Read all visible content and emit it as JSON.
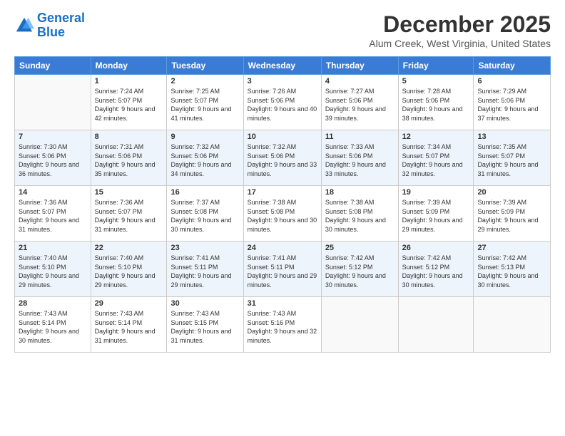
{
  "logo": {
    "line1": "General",
    "line2": "Blue"
  },
  "title": "December 2025",
  "location": "Alum Creek, West Virginia, United States",
  "days_header": [
    "Sunday",
    "Monday",
    "Tuesday",
    "Wednesday",
    "Thursday",
    "Friday",
    "Saturday"
  ],
  "weeks": [
    [
      {
        "num": "",
        "sunrise": "",
        "sunset": "",
        "daylight": ""
      },
      {
        "num": "1",
        "sunrise": "Sunrise: 7:24 AM",
        "sunset": "Sunset: 5:07 PM",
        "daylight": "Daylight: 9 hours and 42 minutes."
      },
      {
        "num": "2",
        "sunrise": "Sunrise: 7:25 AM",
        "sunset": "Sunset: 5:07 PM",
        "daylight": "Daylight: 9 hours and 41 minutes."
      },
      {
        "num": "3",
        "sunrise": "Sunrise: 7:26 AM",
        "sunset": "Sunset: 5:06 PM",
        "daylight": "Daylight: 9 hours and 40 minutes."
      },
      {
        "num": "4",
        "sunrise": "Sunrise: 7:27 AM",
        "sunset": "Sunset: 5:06 PM",
        "daylight": "Daylight: 9 hours and 39 minutes."
      },
      {
        "num": "5",
        "sunrise": "Sunrise: 7:28 AM",
        "sunset": "Sunset: 5:06 PM",
        "daylight": "Daylight: 9 hours and 38 minutes."
      },
      {
        "num": "6",
        "sunrise": "Sunrise: 7:29 AM",
        "sunset": "Sunset: 5:06 PM",
        "daylight": "Daylight: 9 hours and 37 minutes."
      }
    ],
    [
      {
        "num": "7",
        "sunrise": "Sunrise: 7:30 AM",
        "sunset": "Sunset: 5:06 PM",
        "daylight": "Daylight: 9 hours and 36 minutes."
      },
      {
        "num": "8",
        "sunrise": "Sunrise: 7:31 AM",
        "sunset": "Sunset: 5:06 PM",
        "daylight": "Daylight: 9 hours and 35 minutes."
      },
      {
        "num": "9",
        "sunrise": "Sunrise: 7:32 AM",
        "sunset": "Sunset: 5:06 PM",
        "daylight": "Daylight: 9 hours and 34 minutes."
      },
      {
        "num": "10",
        "sunrise": "Sunrise: 7:32 AM",
        "sunset": "Sunset: 5:06 PM",
        "daylight": "Daylight: 9 hours and 33 minutes."
      },
      {
        "num": "11",
        "sunrise": "Sunrise: 7:33 AM",
        "sunset": "Sunset: 5:06 PM",
        "daylight": "Daylight: 9 hours and 33 minutes."
      },
      {
        "num": "12",
        "sunrise": "Sunrise: 7:34 AM",
        "sunset": "Sunset: 5:07 PM",
        "daylight": "Daylight: 9 hours and 32 minutes."
      },
      {
        "num": "13",
        "sunrise": "Sunrise: 7:35 AM",
        "sunset": "Sunset: 5:07 PM",
        "daylight": "Daylight: 9 hours and 31 minutes."
      }
    ],
    [
      {
        "num": "14",
        "sunrise": "Sunrise: 7:36 AM",
        "sunset": "Sunset: 5:07 PM",
        "daylight": "Daylight: 9 hours and 31 minutes."
      },
      {
        "num": "15",
        "sunrise": "Sunrise: 7:36 AM",
        "sunset": "Sunset: 5:07 PM",
        "daylight": "Daylight: 9 hours and 31 minutes."
      },
      {
        "num": "16",
        "sunrise": "Sunrise: 7:37 AM",
        "sunset": "Sunset: 5:08 PM",
        "daylight": "Daylight: 9 hours and 30 minutes."
      },
      {
        "num": "17",
        "sunrise": "Sunrise: 7:38 AM",
        "sunset": "Sunset: 5:08 PM",
        "daylight": "Daylight: 9 hours and 30 minutes."
      },
      {
        "num": "18",
        "sunrise": "Sunrise: 7:38 AM",
        "sunset": "Sunset: 5:08 PM",
        "daylight": "Daylight: 9 hours and 30 minutes."
      },
      {
        "num": "19",
        "sunrise": "Sunrise: 7:39 AM",
        "sunset": "Sunset: 5:09 PM",
        "daylight": "Daylight: 9 hours and 29 minutes."
      },
      {
        "num": "20",
        "sunrise": "Sunrise: 7:39 AM",
        "sunset": "Sunset: 5:09 PM",
        "daylight": "Daylight: 9 hours and 29 minutes."
      }
    ],
    [
      {
        "num": "21",
        "sunrise": "Sunrise: 7:40 AM",
        "sunset": "Sunset: 5:10 PM",
        "daylight": "Daylight: 9 hours and 29 minutes."
      },
      {
        "num": "22",
        "sunrise": "Sunrise: 7:40 AM",
        "sunset": "Sunset: 5:10 PM",
        "daylight": "Daylight: 9 hours and 29 minutes."
      },
      {
        "num": "23",
        "sunrise": "Sunrise: 7:41 AM",
        "sunset": "Sunset: 5:11 PM",
        "daylight": "Daylight: 9 hours and 29 minutes."
      },
      {
        "num": "24",
        "sunrise": "Sunrise: 7:41 AM",
        "sunset": "Sunset: 5:11 PM",
        "daylight": "Daylight: 9 hours and 29 minutes."
      },
      {
        "num": "25",
        "sunrise": "Sunrise: 7:42 AM",
        "sunset": "Sunset: 5:12 PM",
        "daylight": "Daylight: 9 hours and 30 minutes."
      },
      {
        "num": "26",
        "sunrise": "Sunrise: 7:42 AM",
        "sunset": "Sunset: 5:12 PM",
        "daylight": "Daylight: 9 hours and 30 minutes."
      },
      {
        "num": "27",
        "sunrise": "Sunrise: 7:42 AM",
        "sunset": "Sunset: 5:13 PM",
        "daylight": "Daylight: 9 hours and 30 minutes."
      }
    ],
    [
      {
        "num": "28",
        "sunrise": "Sunrise: 7:43 AM",
        "sunset": "Sunset: 5:14 PM",
        "daylight": "Daylight: 9 hours and 30 minutes."
      },
      {
        "num": "29",
        "sunrise": "Sunrise: 7:43 AM",
        "sunset": "Sunset: 5:14 PM",
        "daylight": "Daylight: 9 hours and 31 minutes."
      },
      {
        "num": "30",
        "sunrise": "Sunrise: 7:43 AM",
        "sunset": "Sunset: 5:15 PM",
        "daylight": "Daylight: 9 hours and 31 minutes."
      },
      {
        "num": "31",
        "sunrise": "Sunrise: 7:43 AM",
        "sunset": "Sunset: 5:16 PM",
        "daylight": "Daylight: 9 hours and 32 minutes."
      },
      {
        "num": "",
        "sunrise": "",
        "sunset": "",
        "daylight": ""
      },
      {
        "num": "",
        "sunrise": "",
        "sunset": "",
        "daylight": ""
      },
      {
        "num": "",
        "sunrise": "",
        "sunset": "",
        "daylight": ""
      }
    ]
  ]
}
